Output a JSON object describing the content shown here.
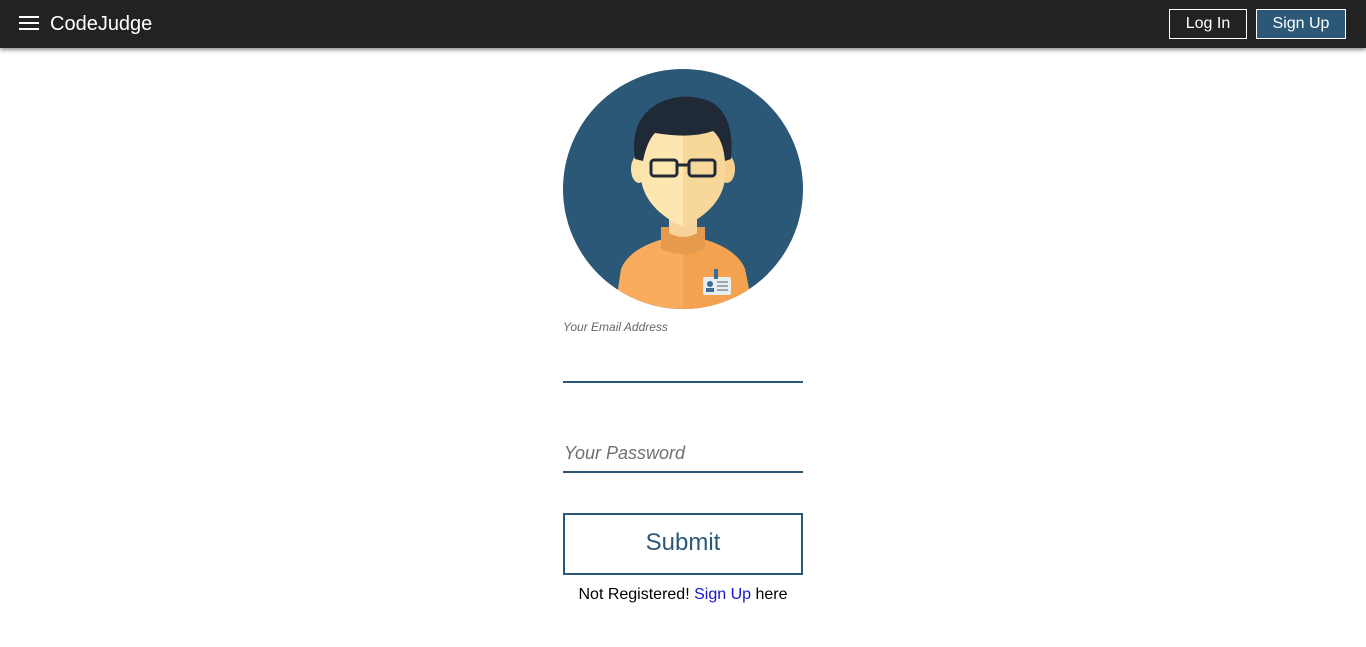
{
  "navbar": {
    "menu_icon": "hamburger-menu-icon",
    "brand": "CodeJudge",
    "login_label": "Log In",
    "signup_label": "Sign Up",
    "background_color": "#222222",
    "signup_color": "#2c5878"
  },
  "avatar": {
    "icon": "user-avatar-icon"
  },
  "form": {
    "email_label": "Your Email Address",
    "email_value": "",
    "password_placeholder": "Your Password",
    "password_value": "",
    "submit_label": "Submit",
    "accent_color": "#2c5878"
  },
  "footer": {
    "prefix": "Not Registered!",
    "link": "Sign Up",
    "suffix": "here"
  }
}
